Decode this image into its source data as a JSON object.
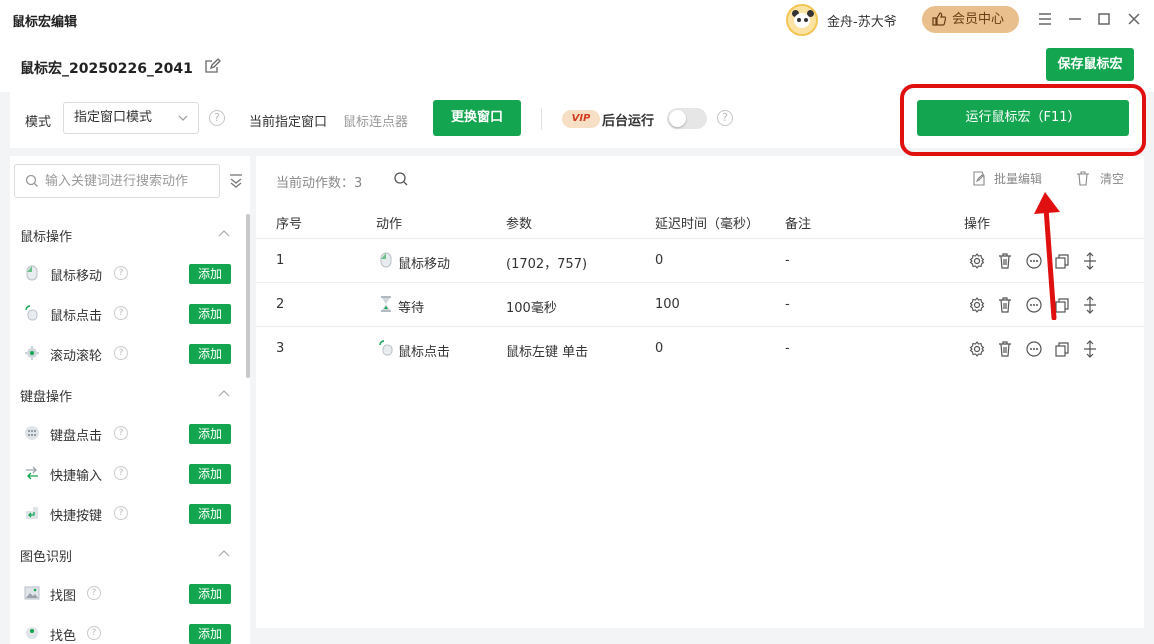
{
  "titlebar": {
    "app_title": "鼠标宏编辑",
    "username": "金舟-苏大爷",
    "vip_label": "会员中心"
  },
  "header": {
    "macro_name": "鼠标宏_20250226_2041",
    "save_label": "保存鼠标宏"
  },
  "toolbar": {
    "mode_label": "模式",
    "mode_value": "指定窗口模式",
    "current_window_label": "当前指定窗口",
    "current_window_value": "鼠标连点器",
    "change_window_label": "更换窗口",
    "vip_tag": "VIP",
    "background_run_label": "后台运行",
    "background_run_on": false,
    "run_label": "运行鼠标宏（F11）"
  },
  "left_panel": {
    "search_placeholder": "输入关键词进行搜索动作",
    "add_label": "添加",
    "sections": [
      {
        "title": "鼠标操作",
        "items": [
          {
            "label": "鼠标移动",
            "icon": "mouse-icon"
          },
          {
            "label": "鼠标点击",
            "icon": "mouse-click-icon"
          },
          {
            "label": "滚动滚轮",
            "icon": "scroll-wheel-icon"
          }
        ]
      },
      {
        "title": "键盘操作",
        "items": [
          {
            "label": "键盘点击",
            "icon": "keyboard-icon"
          },
          {
            "label": "快捷输入",
            "icon": "quick-input-icon"
          },
          {
            "label": "快捷按键",
            "icon": "enter-key-icon"
          }
        ]
      },
      {
        "title": "图色识别",
        "items": [
          {
            "label": "找图",
            "icon": "image-icon"
          },
          {
            "label": "找色",
            "icon": "color-icon"
          }
        ]
      }
    ]
  },
  "main": {
    "count_label": "当前动作数：",
    "count_value": "3",
    "batch_edit_label": "批量编辑",
    "clear_label": "清空",
    "columns": [
      "序号",
      "动作",
      "参数",
      "延迟时间（毫秒）",
      "备注",
      "操作"
    ],
    "rows": [
      {
        "index": "1",
        "action": "鼠标移动",
        "icon": "mouse-icon",
        "param": "(1702，757)",
        "delay": "0",
        "note": "-"
      },
      {
        "index": "2",
        "action": "等待",
        "icon": "hourglass-icon",
        "param": "100毫秒",
        "delay": "100",
        "note": "-"
      },
      {
        "index": "3",
        "action": "鼠标点击",
        "icon": "mouse-click-icon",
        "param": "鼠标左键 单击",
        "delay": "0",
        "note": "-"
      }
    ]
  },
  "colors": {
    "accent_green": "#14a550",
    "highlight_red": "#e01010",
    "vip_gold": "#e8bf8d"
  }
}
